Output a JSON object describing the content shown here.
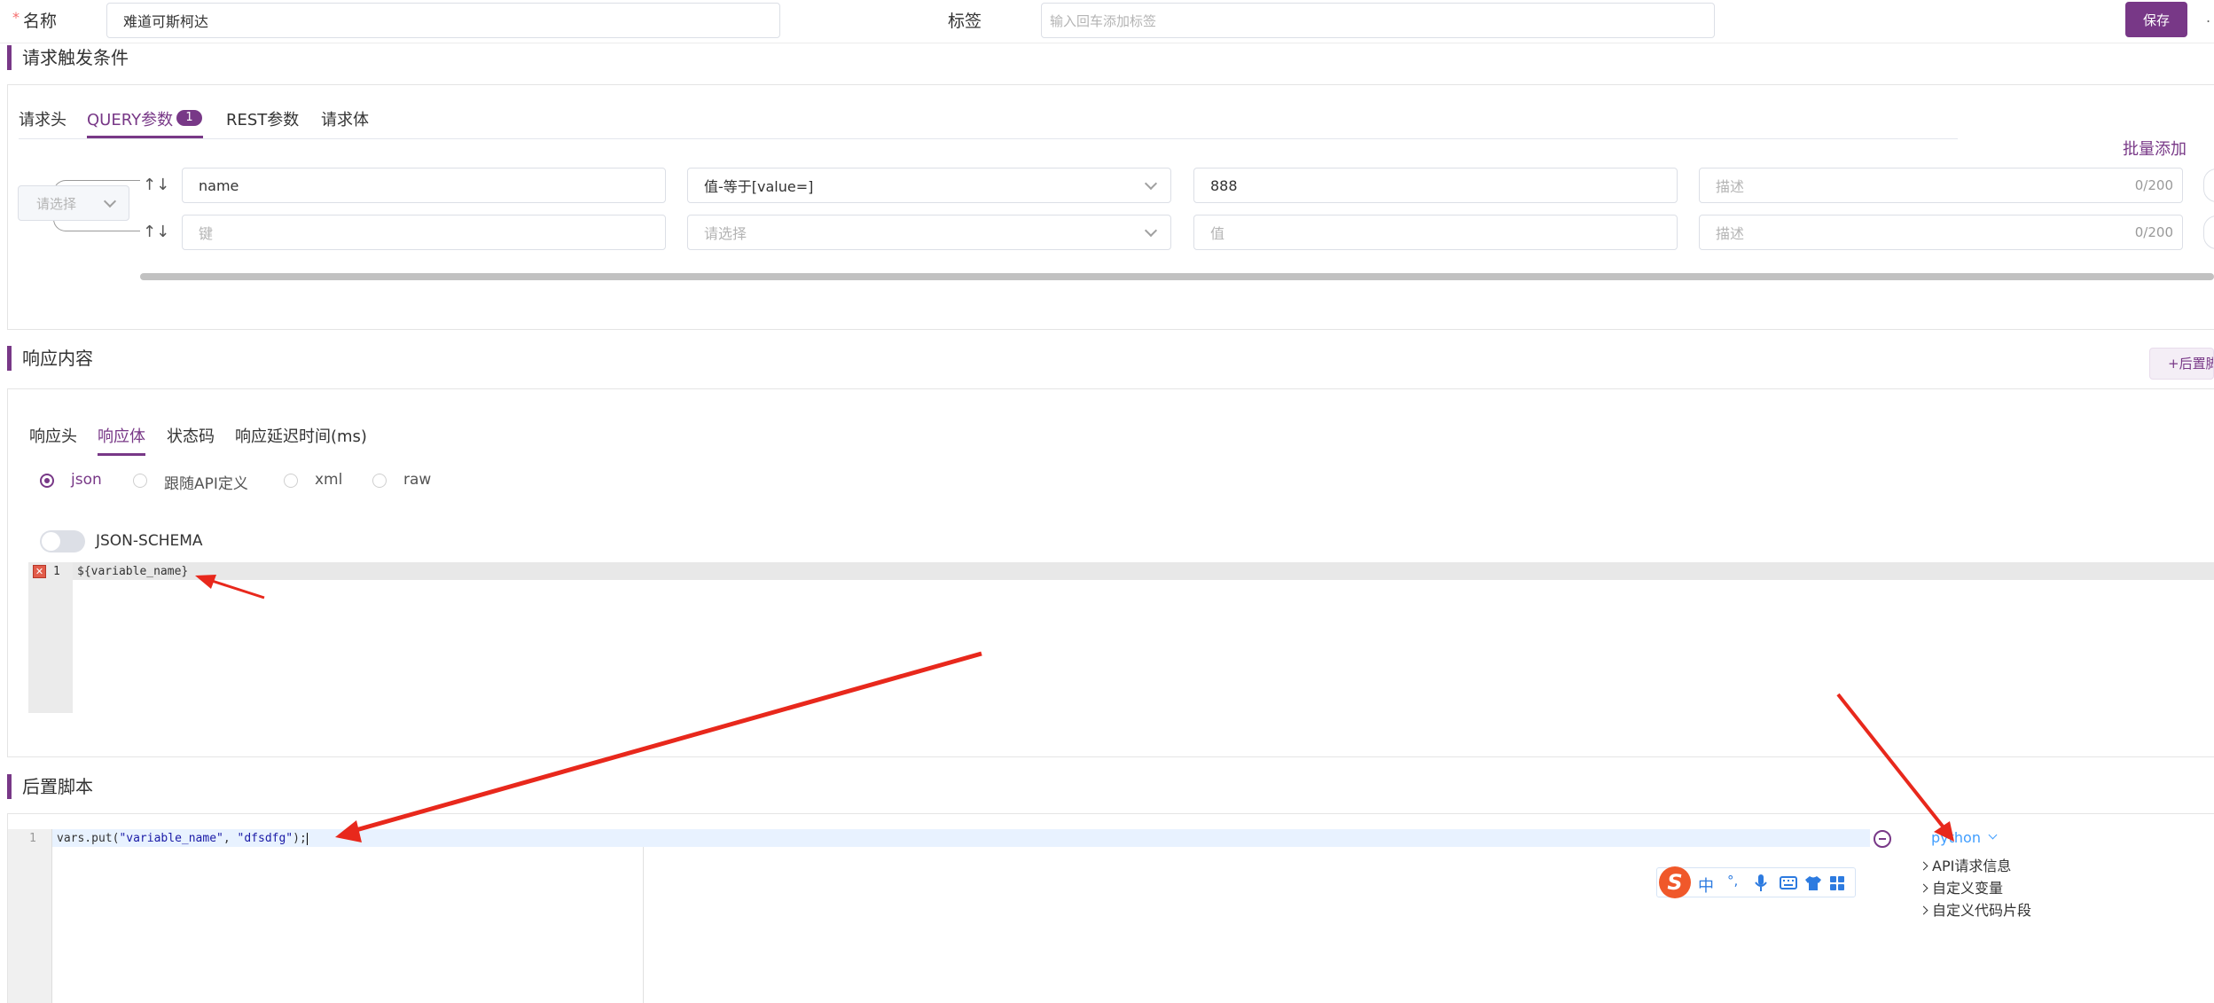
{
  "header": {
    "required_mark": "*",
    "name_label": "名称",
    "name_value": "难道可斯柯达",
    "tags_label": "标签",
    "tags_placeholder": "输入回车添加标签",
    "save_label": "保存"
  },
  "trigger": {
    "title": "请求触发条件",
    "tabs": [
      "请求头",
      "QUERY参数",
      "REST参数",
      "请求体"
    ],
    "active_tab": 1,
    "query_badge": "1",
    "batch_add": "批量添加",
    "logic_select_placeholder": "请选择",
    "rows": [
      {
        "key": "name",
        "condition": "值-等于[value=]",
        "value": "888",
        "desc_placeholder": "描述",
        "count": "0/200"
      },
      {
        "key_placeholder": "键",
        "condition_placeholder": "请选择",
        "value_placeholder": "值",
        "desc_placeholder": "描述",
        "count": "0/200"
      }
    ]
  },
  "response": {
    "title": "响应内容",
    "post_script_button": "+后置脚",
    "tabs": [
      "响应头",
      "响应体",
      "状态码",
      "响应延迟时间(ms)"
    ],
    "active_tab": 1,
    "formats": [
      "json",
      "跟随API定义",
      "xml",
      "raw"
    ],
    "selected_format": "json",
    "schema_label": "JSON-SCHEMA",
    "editor": {
      "line_number": "1",
      "code": "${variable_name}"
    }
  },
  "post_script": {
    "title": "后置脚本",
    "editor": {
      "line_number": "1",
      "code_prefix": "vars.put(",
      "arg1": "\"variable_name\"",
      "comma": ", ",
      "arg2": "\"dfsdfg\"",
      "code_suffix": ");"
    },
    "language": "python",
    "tree": [
      "API请求信息",
      "自定义变量",
      "自定义代码片段"
    ]
  },
  "ime_toolbar": {
    "logo": "S",
    "mode": "中",
    "punct": "°,"
  },
  "colors": {
    "accent": "#783887",
    "annotation": "#e8281c",
    "editor_line": "#e8f2ff"
  }
}
